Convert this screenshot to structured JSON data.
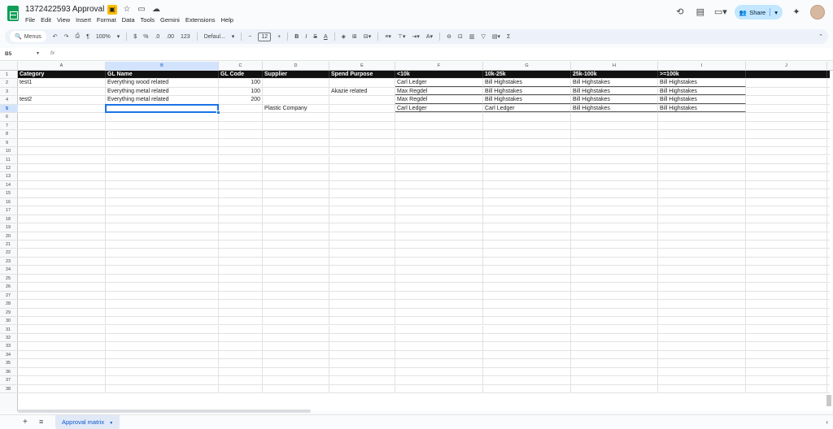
{
  "doc": {
    "title": "1372422593 Approval"
  },
  "menu": [
    "File",
    "Edit",
    "View",
    "Insert",
    "Format",
    "Data",
    "Tools",
    "Gemini",
    "Extensions",
    "Help"
  ],
  "share": {
    "label": "Share"
  },
  "toolbar": {
    "menus_label": "Menus",
    "zoom": "100%",
    "currency": "$",
    "percent": "%",
    "decimal_dec": ".0",
    "decimal_inc": ".00",
    "number_format": "123",
    "font": "Defaul...",
    "font_size": "12",
    "bold": "B",
    "italic": "I",
    "strike": "S",
    "text_color": "A",
    "sum": "Σ"
  },
  "formula": {
    "cell_ref": "B5",
    "fx": "fx",
    "value": ""
  },
  "columns": [
    "A",
    "B",
    "C",
    "D",
    "E",
    "F",
    "G",
    "H",
    "I",
    "J"
  ],
  "rows": [
    "1",
    "2",
    "3",
    "4",
    "5",
    "6",
    "7",
    "8",
    "9",
    "10",
    "11",
    "12",
    "13",
    "14",
    "15",
    "16",
    "17",
    "18",
    "19",
    "20",
    "21",
    "22",
    "23",
    "24",
    "25",
    "26",
    "27",
    "28",
    "29",
    "30",
    "31",
    "32",
    "33",
    "34",
    "35",
    "36",
    "37",
    "38"
  ],
  "table": {
    "headers": [
      "Category",
      "GL Name",
      "GL Code",
      "Supplier",
      "Spend Purpose",
      "<10k",
      "10k-25k",
      "25k-100k",
      ">=100k",
      ""
    ],
    "data": [
      [
        "test1",
        "Everything wood related",
        "100",
        "",
        "",
        "Carl Ledger",
        "Bill Highstakes",
        "Bill Highstakes",
        "Bill Highstakes",
        ""
      ],
      [
        "",
        "Everything metal related",
        "100",
        "",
        "Akazie related",
        "Max Regdel",
        "Bill Highstakes",
        "Bill Highstakes",
        "Bill Highstakes",
        ""
      ],
      [
        "test2",
        "Everything metal related",
        "200",
        "",
        "",
        "Max Regdel",
        "Bill Highstakes",
        "Bill Highstakes",
        "Bill Highstakes",
        ""
      ],
      [
        "",
        "",
        "",
        "Plastic Company",
        "",
        "Carl Ledger",
        "Carl Ledger",
        "Bill Highstakes",
        "Bill Highstakes",
        ""
      ]
    ]
  },
  "sheets": {
    "active": "Approval matrix"
  }
}
